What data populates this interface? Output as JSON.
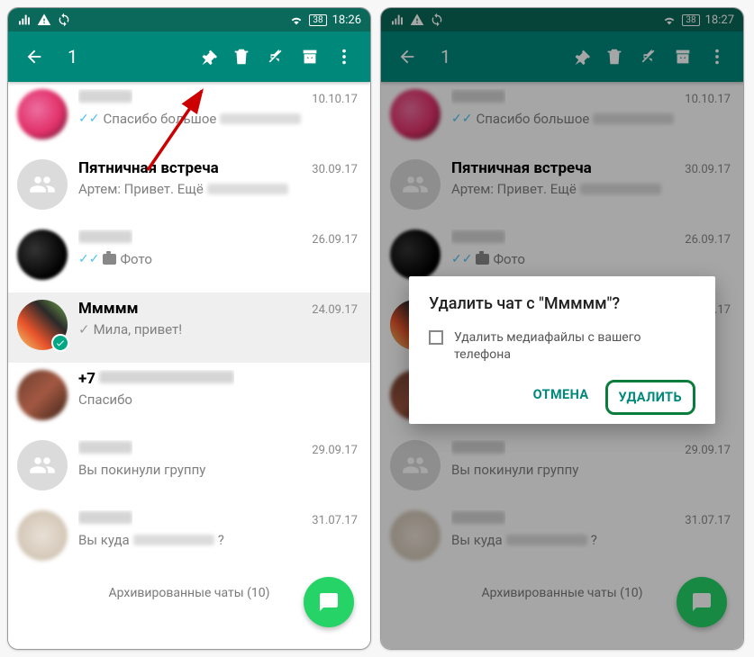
{
  "status": {
    "time_left": "18:26",
    "time_right": "18:27",
    "battery": "38"
  },
  "appbar": {
    "selected_count": "1"
  },
  "chats": [
    {
      "name": "Артем",
      "blurredName": true,
      "date": "10.10.17",
      "ticks": true,
      "snippet": "Спасибо большое",
      "blurredSuffix": true,
      "avatar": "blur1",
      "bold": false
    },
    {
      "name": "Пятничная встреча",
      "blurredName": false,
      "date": "30.09.17",
      "snippet": "Артем: Привет. Ещё",
      "blurredSuffix": true,
      "avatar": "group",
      "bold": true
    },
    {
      "name": "Муж",
      "blurredName": true,
      "date": "26.09.17",
      "ticks": true,
      "camera": true,
      "snippet": "Фото",
      "avatar": "blur2",
      "bold": false
    },
    {
      "name": "Ммммм",
      "blurredName": false,
      "date": "24.09.17",
      "sent": true,
      "snippet": "Мила, привет!",
      "avatar": "sel",
      "bold": true,
      "selected": true
    },
    {
      "name": "+7",
      "blurredName": false,
      "phoneBlur": true,
      "date": "",
      "snippet": "Спасибо",
      "avatar": "blur3",
      "bold": true
    },
    {
      "name": "Подготовительная Г…",
      "blurredName": true,
      "date": "29.09.17",
      "snippet": "Вы покинули группу",
      "avatar": "group",
      "bold": false
    },
    {
      "name": "Стас",
      "blurredName": true,
      "date": "31.07.17",
      "snippet": "Вы куда",
      "blurredSuffix": true,
      "qmark": "?",
      "avatar": "blur4",
      "bold": false
    }
  ],
  "archived": "Архивированные чаты (10)",
  "dialog": {
    "title": "Удалить чат с \"Ммммм\"?",
    "checkbox_label": "Удалить медиафайлы с вашего телефона",
    "cancel": "ОТМЕНА",
    "confirm": "УДАЛИТЬ"
  }
}
